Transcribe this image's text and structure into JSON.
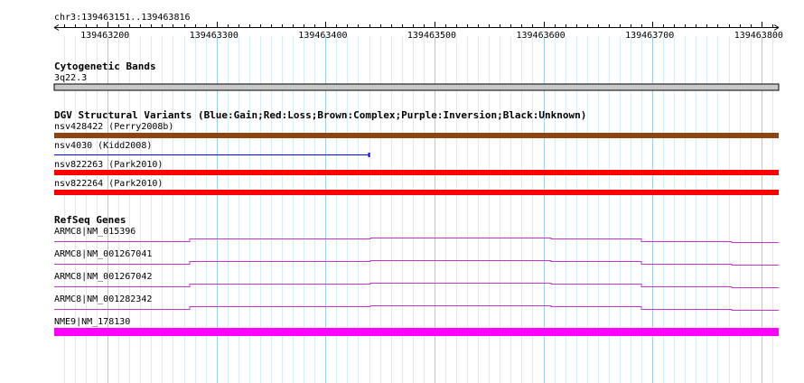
{
  "locus": "chr3:139463151..139463816",
  "view": {
    "start": 139463151,
    "end": 139463816
  },
  "ruler": {
    "ticks": [
      139463200,
      139463300,
      139463400,
      139463500,
      139463600,
      139463700,
      139463800
    ]
  },
  "cytoband": {
    "title": "Cytogenetic Bands",
    "band": "3q22.3",
    "color": "#c8c8c8"
  },
  "dgv": {
    "title": "DGV Structural Variants (Blue:Gain;Red:Loss;Brown:Complex;Purple:Inversion;Black:Unknown)",
    "items": [
      {
        "label": "nsv428422 (Perry2008b)",
        "type": "Complex",
        "color": "#8b4513",
        "start": 139463151,
        "end": 139463816
      },
      {
        "label": "nsv4030 (Kidd2008)",
        "type": "Gain",
        "color": "#0000ff",
        "start": 139463151,
        "end": 139463440
      },
      {
        "label": "nsv822263 (Park2010)",
        "type": "Loss",
        "color": "#ff0000",
        "start": 139463151,
        "end": 139463816
      },
      {
        "label": "nsv822264 (Park2010)",
        "type": "Loss",
        "color": "#ff0000",
        "start": 139463151,
        "end": 139463816
      }
    ]
  },
  "refseq": {
    "title": "RefSeq Genes",
    "intron_color": "#cc33cc",
    "exon_color": "#ff00ff",
    "genes": [
      {
        "label": "ARMC8|NM_015396",
        "feature": "intron"
      },
      {
        "label": "ARMC8|NM_001267041",
        "feature": "intron"
      },
      {
        "label": "ARMC8|NM_001267042",
        "feature": "intron"
      },
      {
        "label": "ARMC8|NM_001282342",
        "feature": "intron"
      },
      {
        "label": "NME9|NM_178130",
        "feature": "exon"
      }
    ]
  }
}
